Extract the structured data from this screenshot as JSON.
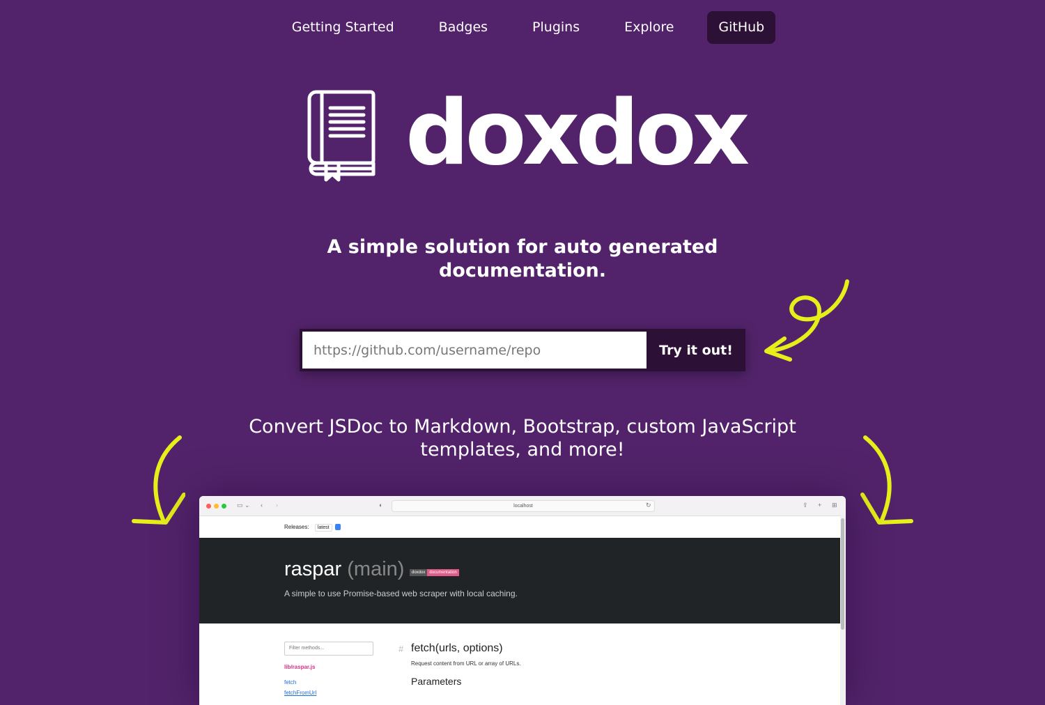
{
  "nav": {
    "items": [
      {
        "label": "Getting Started"
      },
      {
        "label": "Badges"
      },
      {
        "label": "Plugins"
      },
      {
        "label": "Explore"
      },
      {
        "label": "GitHub"
      }
    ],
    "active": "GitHub"
  },
  "brand": {
    "name": "doxdox",
    "icon": "book-icon"
  },
  "hero": {
    "tagline": "A simple solution for auto generated documentation.",
    "subline": "Convert JSDoc to Markdown, Bootstrap, custom JavaScript templates, and more!"
  },
  "try_form": {
    "placeholder": "https://github.com/username/repo",
    "value": "",
    "button_label": "Try it out!"
  },
  "colors": {
    "background": "#52236a",
    "nav_active": "#2c1036",
    "arrow": "#e6ef1a",
    "badge_accent": "#e05d8a",
    "link": "#1a6ce0"
  },
  "preview": {
    "url": "localhost",
    "releases_label": "Releases:",
    "releases_value": "latest",
    "project_name": "raspar",
    "project_branch": "(main)",
    "badge_left": "doxdox",
    "badge_right": "documentation",
    "project_description": "A simple to use Promise-based web scraper with local caching.",
    "filter_placeholder": "Filter methods...",
    "sidebar_file": "lib/raspar.js",
    "sidebar_links": [
      "fetch",
      "fetchFromUrl"
    ],
    "method_title": "fetch(urls, options)",
    "method_description": "Request content from URL or array of URLs.",
    "parameters_heading": "Parameters"
  }
}
